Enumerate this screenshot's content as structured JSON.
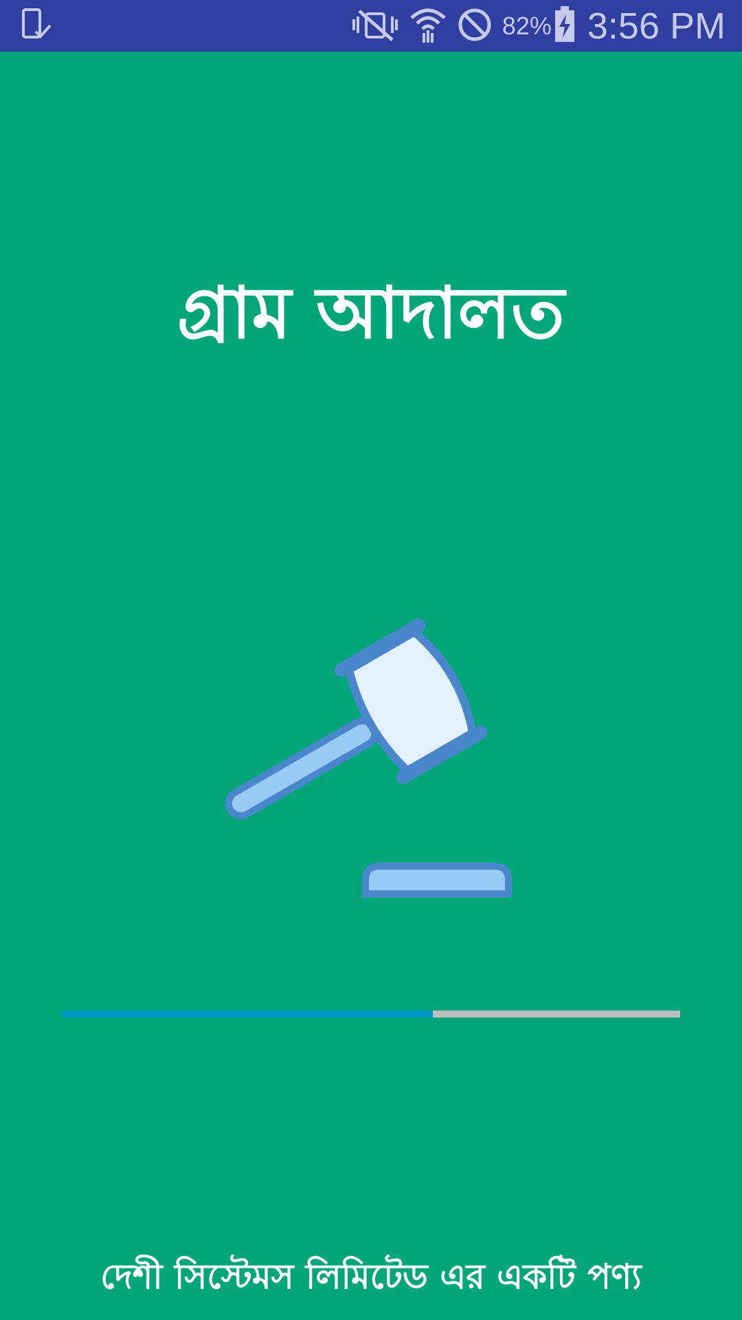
{
  "status_bar": {
    "battery_percent": "82%",
    "time": "3:56 PM",
    "icons": [
      "device-check-icon",
      "vibrate-off-icon",
      "wifi-icon",
      "do-not-disturb-icon",
      "battery-charging-icon"
    ],
    "background_color": "#303F9F"
  },
  "splash": {
    "title": "গ্রাম আদালত",
    "icon": "gavel-icon",
    "footer": "দেশী সিস্টেমস লিমিটেড এর একটি পণ্য",
    "background_color": "#03A679"
  },
  "progress": {
    "fraction": 0.6,
    "fill_color": "#0097C6",
    "track_color": "#BDBDBD"
  }
}
